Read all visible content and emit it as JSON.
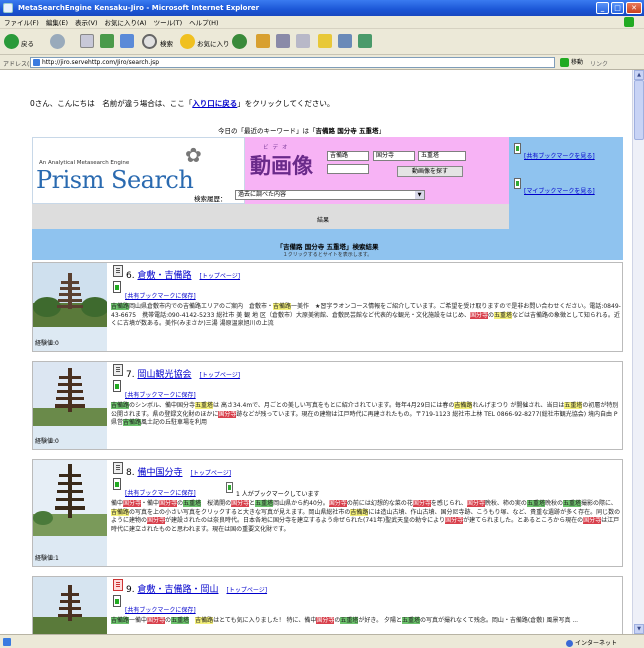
{
  "window": {
    "title": "MetaSearchEngine Kensaku-Jiro - Microsoft Internet Explorer"
  },
  "menu": [
    "ファイル(F)",
    "編集(E)",
    "表示(V)",
    "お気に入り(A)",
    "ツール(T)",
    "ヘルプ(H)"
  ],
  "toolbar": {
    "back": "戻る",
    "search": "検索",
    "favorites": "お気に入り"
  },
  "address": {
    "label": "アドレス(D)",
    "url": "http://jiro.servehttp.com/Jiro/search.jsp",
    "go": "移動",
    "links": "リンク"
  },
  "greeting": {
    "prefix": "0さん、こんにちは　名前が違う場合は、ここ「",
    "link": "入り口に戻る",
    "suffix": "」をクリックしてください。"
  },
  "keyword": {
    "prefix": "今日の「最近のキーワード」は「",
    "value": "吉備路 国分寺 五重塔",
    "suffix": "」"
  },
  "logo": {
    "sub": "An Analytical Metasearch Engine",
    "text": "Prism Search"
  },
  "video": {
    "title": "動画像",
    "ruby": "ビデオ",
    "inputs": [
      "吉備路",
      "国分寺",
      "五重塔",
      ""
    ],
    "button": "動画像を探す"
  },
  "bookmarks": {
    "shared": "[共有ブックマークを見る]",
    "mine": "[マイブックマークを見る]"
  },
  "history": {
    "label": "検索履歴：",
    "value": "過去に調べた内容"
  },
  "results_label": "結果",
  "results_header": {
    "title": "「吉備路 国分寺 五重塔」検索結果",
    "note": "１クリックするとサイトを表示します。"
  },
  "results": [
    {
      "num": "6.",
      "name": "倉敷・吉備路",
      "top": "[トップページ]",
      "save": "[共有ブックマークに保存]",
      "views": "経験値:0",
      "snippet": [
        {
          "t": "吉備路",
          "h": "g"
        },
        {
          "t": "岡山県倉敷市内での吉備路エリアのご案内　倉敷市・"
        },
        {
          "t": "吉備路",
          "h": "y"
        },
        {
          "t": "一美作　★習字ラオンコース情報をご紹介しています。ご希望を受け取りますので是非お問い合わせください。電話:0849-43-6675　携帯電話:090-4142-5233 総社市 美 観 地 区（倉敷市）大原美術館、倉敷民芸館など代表的な観光・文化施設をはじめ、"
        },
        {
          "t": "国分寺",
          "h": "r"
        },
        {
          "t": "の"
        },
        {
          "t": "五重塔",
          "h": "y"
        },
        {
          "t": "などは吉備路の象徴として知られる。近くに古墳が数ある。美作(みまさか)三湯 湯原温泉旭川の上流"
        }
      ]
    },
    {
      "num": "7.",
      "name": "岡山観光協会",
      "top": "[トップページ]",
      "save": "[共有ブックマークに保存]",
      "views": "経験値:0",
      "snippet": [
        {
          "t": "吉備路",
          "h": "g"
        },
        {
          "t": "のシンボル、備中国分寺"
        },
        {
          "t": "五重塔",
          "h": "y"
        },
        {
          "t": "は 高さ34.4mで、月ごとの美しい写真をもとに紹介されています。毎年4月29日には春の"
        },
        {
          "t": "吉備路",
          "h": "y"
        },
        {
          "t": "れんげまつり が開催され、当日は"
        },
        {
          "t": "五重塔",
          "h": "y"
        },
        {
          "t": "の初層が特別公開されます。県の登録文化財のほかに"
        },
        {
          "t": "国分寺",
          "h": "r"
        },
        {
          "t": "跡などが残っています。現在の建物は江戸時代に再建されたもの。〒719-1123 総社市上林 TEL 0866-92-8277(総社市観光協会) 境内自由 P県営"
        },
        {
          "t": "吉備路",
          "h": "g"
        },
        {
          "t": "風土記の丘駐車場を利用"
        }
      ]
    },
    {
      "num": "8.",
      "name": "備中国分寺",
      "top": "[トップページ]",
      "save": "[共有ブックマークに保存]",
      "views": "経験値:1",
      "bmcount": "1 人がブックマークしています",
      "snippet": [
        {
          "t": "備中"
        },
        {
          "t": "国分寺",
          "h": "r"
        },
        {
          "t": "・備中"
        },
        {
          "t": "国分寺",
          "h": "r"
        },
        {
          "t": "の"
        },
        {
          "t": "五重塔",
          "h": "g"
        },
        {
          "t": "　桜満開の"
        },
        {
          "t": "国分寺",
          "h": "r"
        },
        {
          "t": "と"
        },
        {
          "t": "五重塔",
          "h": "g"
        },
        {
          "t": "岡山県から約40分。"
        },
        {
          "t": "国分寺",
          "h": "r"
        },
        {
          "t": "の前には幻想的な菜の花"
        },
        {
          "t": "国分寺",
          "h": "r"
        },
        {
          "t": "を感じられ、"
        },
        {
          "t": "国分寺",
          "h": "r"
        },
        {
          "t": "晩秋、柿の実の"
        },
        {
          "t": "五重塔",
          "h": "g"
        },
        {
          "t": "晩秋の"
        },
        {
          "t": "五重塔",
          "h": "g"
        },
        {
          "t": "撮影の際に、"
        },
        {
          "t": "吉備路",
          "h": "y"
        },
        {
          "t": "の写真を上の小さい写真をクリックすると大きな写真が見えます。岡山県総社市の"
        },
        {
          "t": "吉備路",
          "h": "y"
        },
        {
          "t": "には造山古墳、作山古墳、国分尼寺跡、こうもり塚、など、貴重な遺跡が多く存在。同じ数のように建物の"
        },
        {
          "t": "国分寺",
          "h": "r"
        },
        {
          "t": "が建設されたのは奈良時代。日本各地に国分寺を建立するよう命ぜられた(741年)聖武天皇の勅令により"
        },
        {
          "t": "国分寺",
          "h": "r"
        },
        {
          "t": "が建てられました。とあるところから現在の"
        },
        {
          "t": "国分寺",
          "h": "r"
        },
        {
          "t": "は江戸時代に建立されたものと思われます。現在は国の重要文化財です。"
        }
      ]
    },
    {
      "num": "9.",
      "name": "倉敷・吉備路・岡山",
      "top": "[トップページ]",
      "save": "[共有ブックマークに保存]",
      "views": "",
      "snippet": [
        {
          "t": "吉備路",
          "h": "g"
        },
        {
          "t": "一備中"
        },
        {
          "t": "国分寺",
          "h": "r"
        },
        {
          "t": "の"
        },
        {
          "t": "五重塔",
          "h": "g"
        },
        {
          "t": "　"
        },
        {
          "t": "吉備路",
          "h": "y"
        },
        {
          "t": "はとても気に入りました！ 特に、備中"
        },
        {
          "t": "国分寺",
          "h": "r"
        },
        {
          "t": "の"
        },
        {
          "t": "五重塔",
          "h": "g"
        },
        {
          "t": "が好き。 夕陽と"
        },
        {
          "t": "五重塔",
          "h": "g"
        },
        {
          "t": "の写真が撮れなくて残念。岡山・吉備路(倉敷) 風景写真 ..."
        }
      ]
    }
  ],
  "status": {
    "zone": "インターネット"
  }
}
